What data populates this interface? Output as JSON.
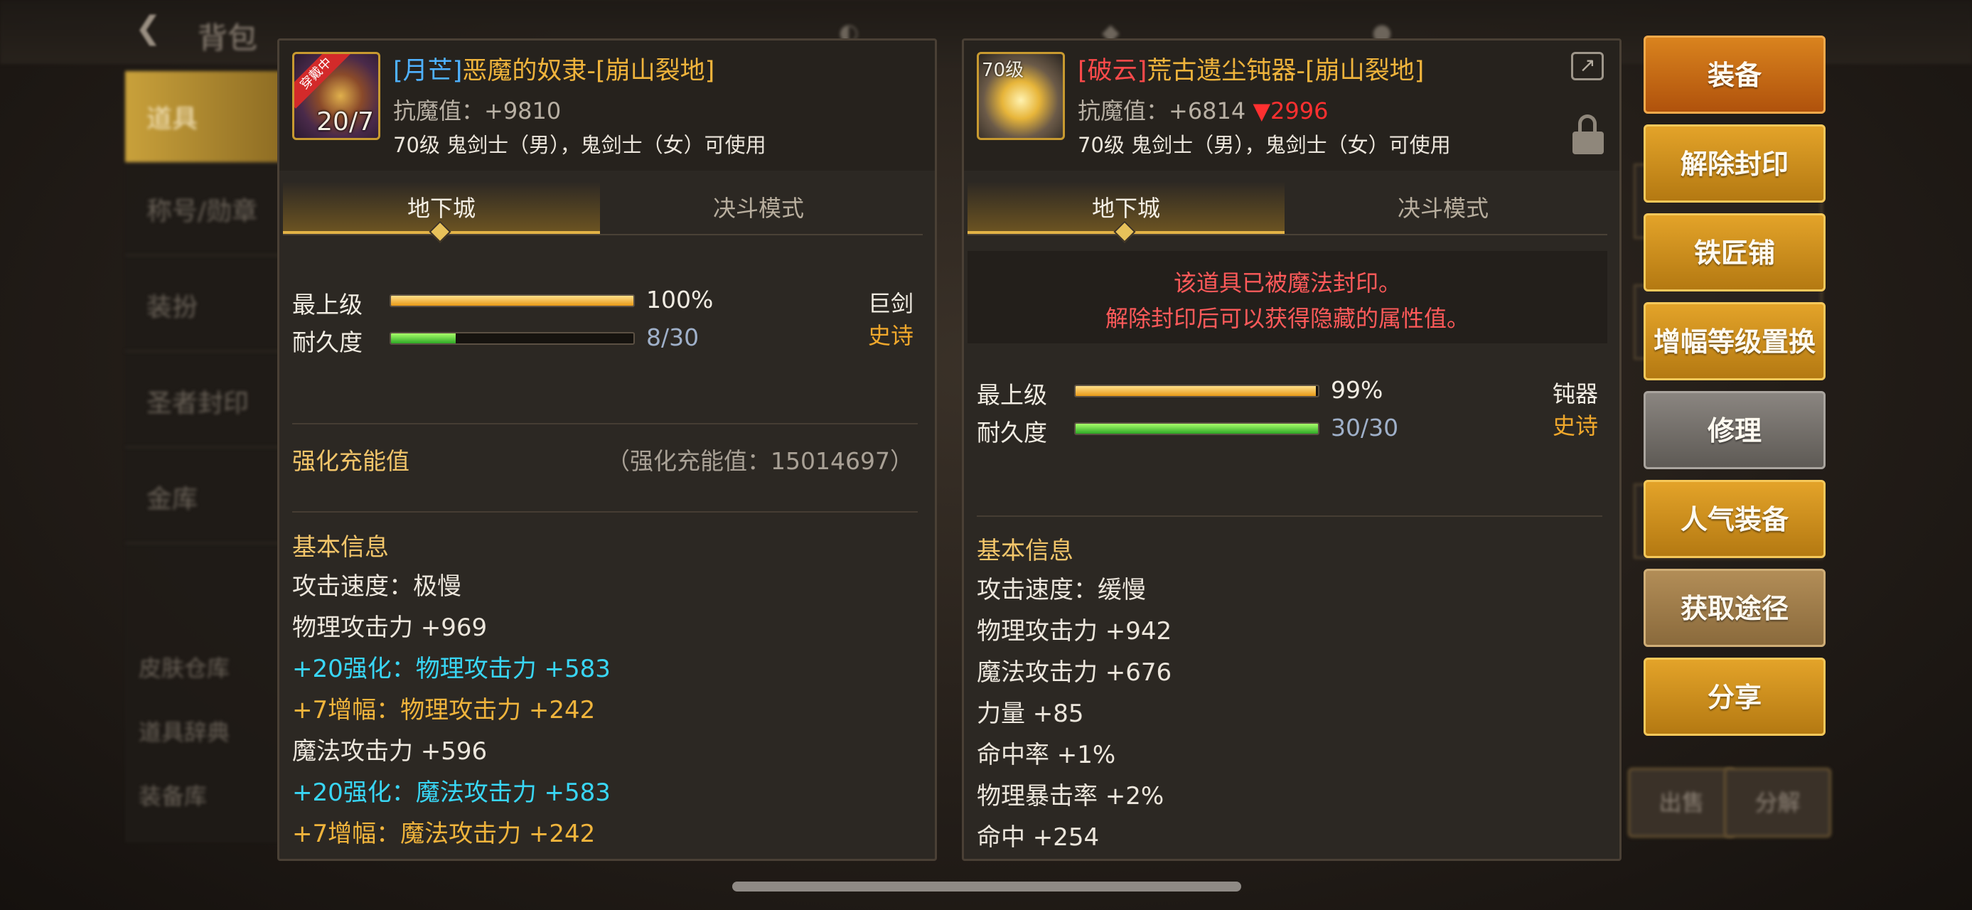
{
  "background": {
    "title": "背包",
    "sidebar": [
      "道具",
      "称号/勋章",
      "装扮",
      "圣者封印",
      "金库"
    ],
    "sidebar_lower": [
      "皮肤仓库",
      "道具辞典",
      "装备库"
    ],
    "bottom_buttons": [
      "出售",
      "分解"
    ]
  },
  "left_item": {
    "badge": "穿戴中",
    "icon_level": "20/7",
    "name_prefix": "[月芒]",
    "name_main": "恶魔的奴隶-[崩山裂地]",
    "anti_magic": "抗魔值：+9810",
    "usable": "70级 鬼剑士（男），鬼剑士（女）可使用",
    "tabs": {
      "active": "地下城",
      "inactive": "决斗模式"
    },
    "grade_label": "最上级",
    "grade_value": "100%",
    "grade_fraction": 1.0,
    "durability_label": "耐久度",
    "durability_value": "8/30",
    "durability_fraction": 0.2667,
    "weapon_type": "巨剑",
    "rarity": "史诗",
    "charge_label": "强化充能值",
    "charge_value": "（强化充能值：15014697）",
    "basic_info": "基本信息",
    "stats": [
      {
        "text": "攻击速度：极慢",
        "color": "white"
      },
      {
        "text": "物理攻击力 +969",
        "color": "white"
      },
      {
        "text": "+20强化：物理攻击力 +583",
        "color": "cyan"
      },
      {
        "text": " +7增幅：物理攻击力 +242",
        "color": "gold"
      },
      {
        "text": "魔法攻击力 +596",
        "color": "white"
      },
      {
        "text": "+20强化：魔法攻击力 +583",
        "color": "cyan"
      },
      {
        "text": " +7增幅：魔法攻击力 +242",
        "color": "gold"
      }
    ]
  },
  "right_item": {
    "icon_level": "70级",
    "name_prefix": "[破云]",
    "name_main": "荒古遗尘钝器-[崩山裂地]",
    "anti_magic": "抗魔值：+6814",
    "anti_magic_diff": "▼2996",
    "usable": "70级 鬼剑士（男），鬼剑士（女）可使用",
    "tabs": {
      "active": "地下城",
      "inactive": "决斗模式"
    },
    "seal_line1": "该道具已被魔法封印。",
    "seal_line2": "解除封印后可以获得隐藏的属性值。",
    "grade_label": "最上级",
    "grade_value": "99%",
    "grade_fraction": 0.99,
    "durability_label": "耐久度",
    "durability_value": "30/30",
    "durability_fraction": 1.0,
    "weapon_type": "钝器",
    "rarity": "史诗",
    "basic_info": "基本信息",
    "stats": [
      "攻击速度：缓慢",
      "物理攻击力 +942",
      "魔法攻击力 +676",
      "力量 +85",
      "命中率 +1%",
      "物理暴击率 +2%",
      "命中 +254"
    ]
  },
  "actions": [
    {
      "label": "装备",
      "style": "orange"
    },
    {
      "label": "解除封印",
      "style": "gold"
    },
    {
      "label": "铁匠铺",
      "style": "gold"
    },
    {
      "label": "增幅等级置换",
      "style": "gold"
    },
    {
      "label": "修理",
      "style": "gray"
    },
    {
      "label": "人气装备",
      "style": "gold"
    },
    {
      "label": "获取途径",
      "style": "tan"
    },
    {
      "label": "分享",
      "style": "gold"
    }
  ],
  "colors": {
    "prefix_blue": "#4fb2ff",
    "prefix_red": "#ff4a4a",
    "name_gold": "#f0b43c",
    "stat_cyan": "#39d6f5",
    "seal_red": "#ff5a5a",
    "epic_orange": "#f0a82c"
  }
}
